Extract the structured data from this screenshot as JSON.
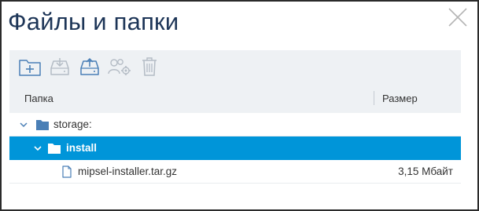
{
  "dialog": {
    "title": "Файлы и папки",
    "close_icon": "close-icon"
  },
  "toolbar": {
    "buttons": [
      {
        "icon": "new-folder-icon"
      },
      {
        "icon": "download-icon"
      },
      {
        "icon": "upload-icon"
      },
      {
        "icon": "permissions-icon"
      },
      {
        "icon": "trash-icon"
      }
    ]
  },
  "table": {
    "columns": {
      "name": "Папка",
      "size": "Размер"
    },
    "rows": [
      {
        "name": "storage:",
        "type": "folder",
        "expanded": true,
        "selected": false,
        "size": ""
      },
      {
        "name": "install",
        "type": "folder",
        "expanded": true,
        "selected": true,
        "size": ""
      },
      {
        "name": "mipsel-installer.tar.gz",
        "type": "file",
        "selected": false,
        "size": "3,15 Мбайт"
      }
    ]
  },
  "colors": {
    "title": "#1d3557",
    "accent": "#0095d9",
    "folder": "#4a7fb6",
    "toolbar_bg": "#eef1f4"
  }
}
